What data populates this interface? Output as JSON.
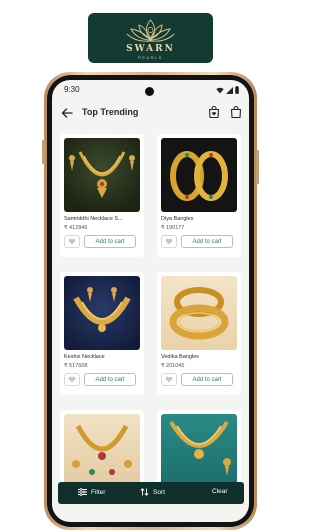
{
  "brand": {
    "name": "SWARN",
    "sub": "PEARLS",
    "colors": {
      "card": "#143a34",
      "gold": "#e9d9a8"
    }
  },
  "status": {
    "time": "9:30"
  },
  "header": {
    "title": "Top Trending",
    "back_icon": "arrow-left-icon",
    "action_icons": [
      "shopping-bag-heart-icon",
      "shopping-bag-icon"
    ]
  },
  "products": [
    {
      "name": "Samriddhi Necklace S...",
      "price": "₹ 412846",
      "cart_label": "Add to cart"
    },
    {
      "name": "Diya Bangles",
      "price": "₹ 190177",
      "cart_label": "Add to cart"
    },
    {
      "name": "Keshvi Necklace",
      "price": "₹ 517608",
      "cart_label": "Add to cart"
    },
    {
      "name": "Vedika Bangles",
      "price": "₹ 201045",
      "cart_label": "Add to cart"
    }
  ],
  "bottom_bar": {
    "filter_label": "Filter",
    "sort_label": "Sort",
    "clear_label": "Clear",
    "color": "#0f2f2a"
  },
  "colors": {
    "accent": "#3c7c5e",
    "screen_bg": "#f4f5f2",
    "frame_gold": "#d8b089"
  }
}
